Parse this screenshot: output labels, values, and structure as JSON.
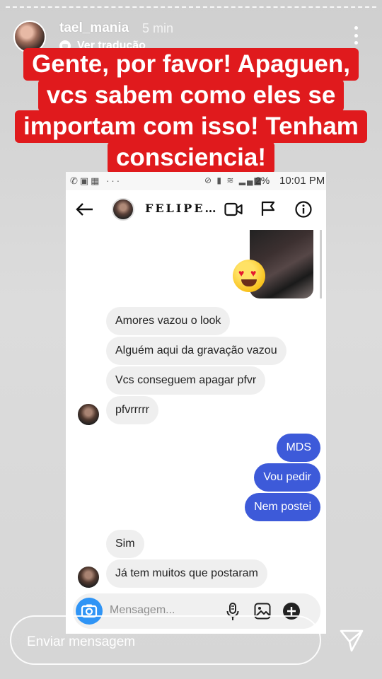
{
  "story": {
    "username": "tael_mania",
    "time_ago": "5 min",
    "translate_label": "Ver tradução"
  },
  "caption": {
    "lines": [
      "Gente, por favor! Apaguen,",
      "vcs sabem como eles se",
      "importam com isso! Tenham",
      "consciencia!"
    ]
  },
  "screenshot": {
    "status_bar": {
      "battery": "2%",
      "time": "10:01 PM"
    },
    "chat_header": {
      "name": "FELIPE…"
    },
    "messages": [
      {
        "text": "Amores vazou o look",
        "side": "in"
      },
      {
        "text": "Alguém aqui da gravação vazou",
        "side": "in"
      },
      {
        "text": "Vcs conseguem apagar pfvr",
        "side": "in"
      },
      {
        "text": "pfvrrrrr",
        "side": "in"
      },
      {
        "text": "MDS",
        "side": "out"
      },
      {
        "text": "Vou pedir",
        "side": "out"
      },
      {
        "text": "Nem postei",
        "side": "out"
      },
      {
        "text": "Sim",
        "side": "in"
      },
      {
        "text": "Já tem muitos que postaram",
        "side": "in"
      }
    ],
    "composer_placeholder": "Mensagem..."
  },
  "reply": {
    "placeholder": "Enviar mensagem"
  },
  "colors": {
    "caption_bg": "#e01a1d",
    "outgoing_bubble": "#3d5ad9",
    "incoming_bubble": "#efefef",
    "camera_button": "#2f94f5"
  }
}
